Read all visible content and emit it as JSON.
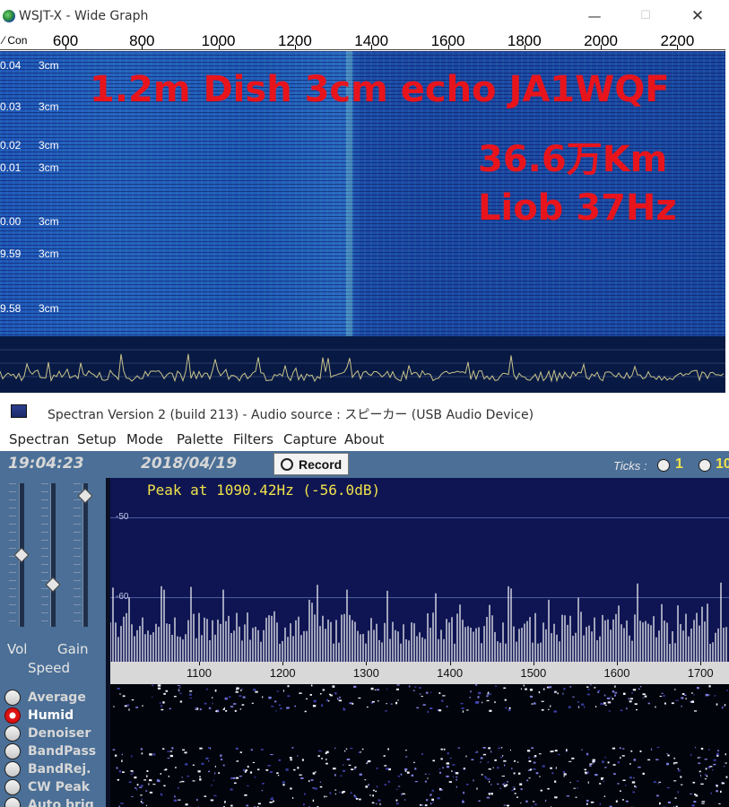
{
  "wsjt": {
    "title": "WSJT-X - Wide Graph",
    "con_label": "Con",
    "freq_ticks": [
      "600",
      "800",
      "1000",
      "1200",
      "1400",
      "1600",
      "1800",
      "2000",
      "2200"
    ],
    "time_marks": [
      {
        "time": "0.04",
        "band": "3cm"
      },
      {
        "time": "0.03",
        "band": "3cm"
      },
      {
        "time": "0.02",
        "band": "3cm"
      },
      {
        "time": "0.01",
        "band": "3cm"
      },
      {
        "time": "0.00",
        "band": "3cm"
      },
      {
        "time": "9.59",
        "band": "3cm"
      },
      {
        "time": "9.58",
        "band": "3cm"
      }
    ],
    "overlay": {
      "line1": "1.2m Dish 3cm echo  JA1WQF",
      "line2": "36.6万Km",
      "line3": "Liob 37Hz"
    }
  },
  "spectran": {
    "title": "Spectran Version 2  (build 213) - Audio source  :  スピーカー (USB Audio Device)",
    "menu": [
      "Spectran",
      "Setup",
      "Mode",
      "Palette",
      "Filters",
      "Capture",
      "About"
    ],
    "time": "19:04:23",
    "date": "2018/04/19",
    "record_label": "Record",
    "ticks_label": "Ticks :",
    "ticks_options": [
      "1",
      "10"
    ],
    "slider_labels": {
      "vol": "Vol",
      "gain": "Gain",
      "speed": "Speed"
    },
    "peak_text": "Peak at  1090.42Hz (-56.0dB)",
    "db_labels": [
      "-50",
      "-60"
    ],
    "freq_ticks": [
      "1100",
      "1200",
      "1300",
      "1400",
      "1500",
      "1600",
      "1700"
    ],
    "options": [
      {
        "label": "Average",
        "active": false
      },
      {
        "label": "Humid",
        "active": true
      },
      {
        "label": "Denoiser",
        "active": false
      },
      {
        "label": "BandPass",
        "active": false
      },
      {
        "label": "BandRej.",
        "active": false
      },
      {
        "label": "CW Peak",
        "active": false
      },
      {
        "label": "Auto brig",
        "active": false
      }
    ]
  },
  "colors": {
    "overlay_red": "#e8141c",
    "peak_yellow": "#f0e24a",
    "waterfall_blue": "#1f57b8",
    "spectrum_trace": "#c9c38a"
  }
}
